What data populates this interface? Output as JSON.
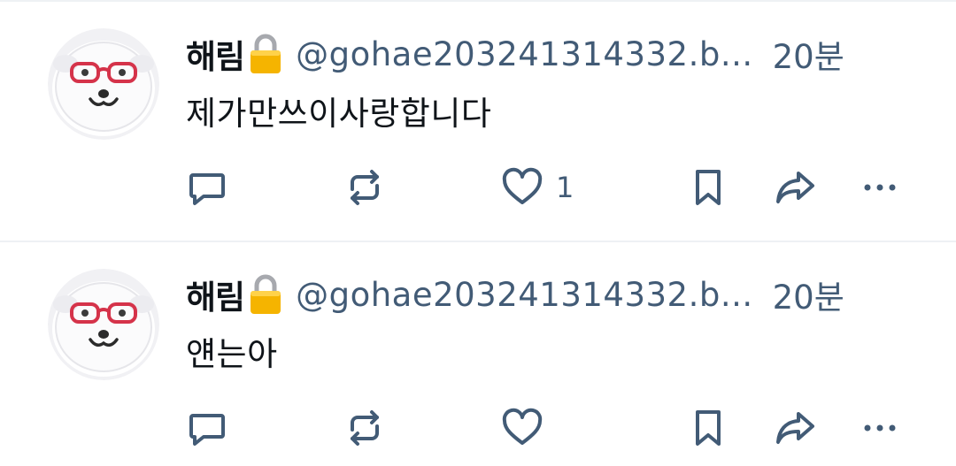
{
  "posts": [
    {
      "author_name": "해림",
      "handle": "@gohae203241314332.b...",
      "time": "20분",
      "text": "제가만쓰이사랑합니다",
      "like_count": "1"
    },
    {
      "author_name": "해림",
      "handle": "@gohae203241314332.b...",
      "time": "20분",
      "text": "얜는아",
      "like_count": ""
    }
  ],
  "icons": {
    "reply": "speech-bubble-icon",
    "repost": "repost-arrows-icon",
    "like": "heart-icon",
    "bookmark": "bookmark-icon",
    "share": "share-arrow-icon",
    "more": "ellipsis-icon",
    "lock": "lock-emoji-icon"
  },
  "colors": {
    "text": "#0f1419",
    "muted": "#425b76",
    "divider": "#eef1f4"
  }
}
